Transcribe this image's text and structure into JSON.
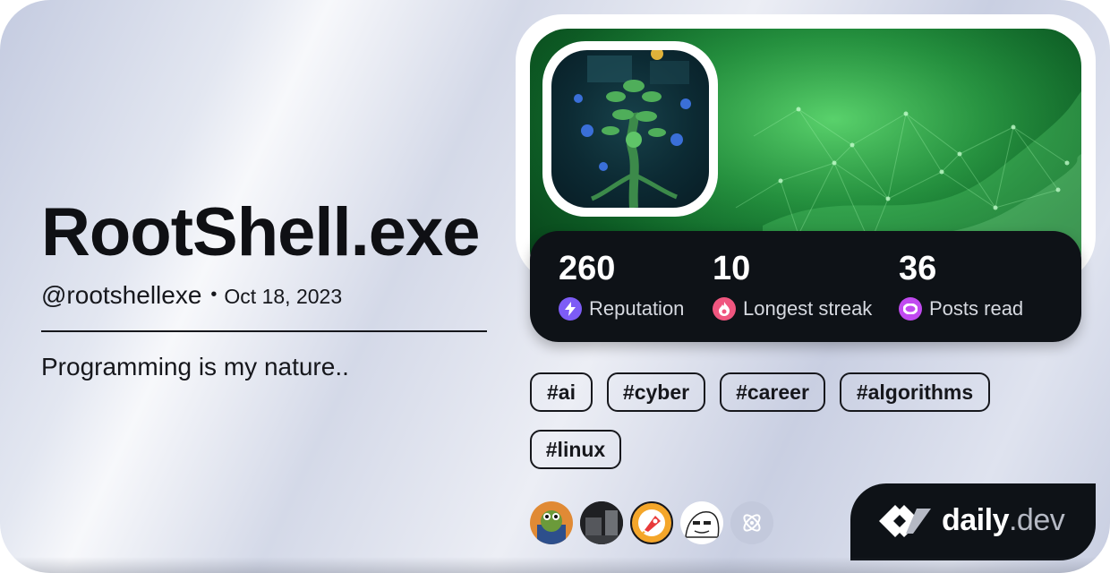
{
  "profile": {
    "name": "RootShell.exe",
    "handle": "@rootshellexe",
    "separator": "•",
    "joined": "Oct 18, 2023",
    "bio": "Programming is my nature.."
  },
  "stats": [
    {
      "value": "260",
      "label": "Reputation",
      "icon": "lightning-icon",
      "color": "#7d5cf6"
    },
    {
      "value": "10",
      "label": "Longest streak",
      "icon": "flame-icon",
      "color": "#f0567f"
    },
    {
      "value": "36",
      "label": "Posts read",
      "icon": "eye-icon",
      "color": "#c14af0"
    }
  ],
  "tags": [
    "#ai",
    "#cyber",
    "#career",
    "#algorithms",
    "#linux"
  ],
  "squads": [
    {
      "icon": "frog-squad-icon"
    },
    {
      "icon": "dark-room-squad-icon"
    },
    {
      "icon": "rocket-squad-icon"
    },
    {
      "icon": "meme-face-squad-icon"
    },
    {
      "icon": "atom-squad-icon"
    }
  ],
  "brand": {
    "name": "daily",
    "suffix": ".dev"
  }
}
